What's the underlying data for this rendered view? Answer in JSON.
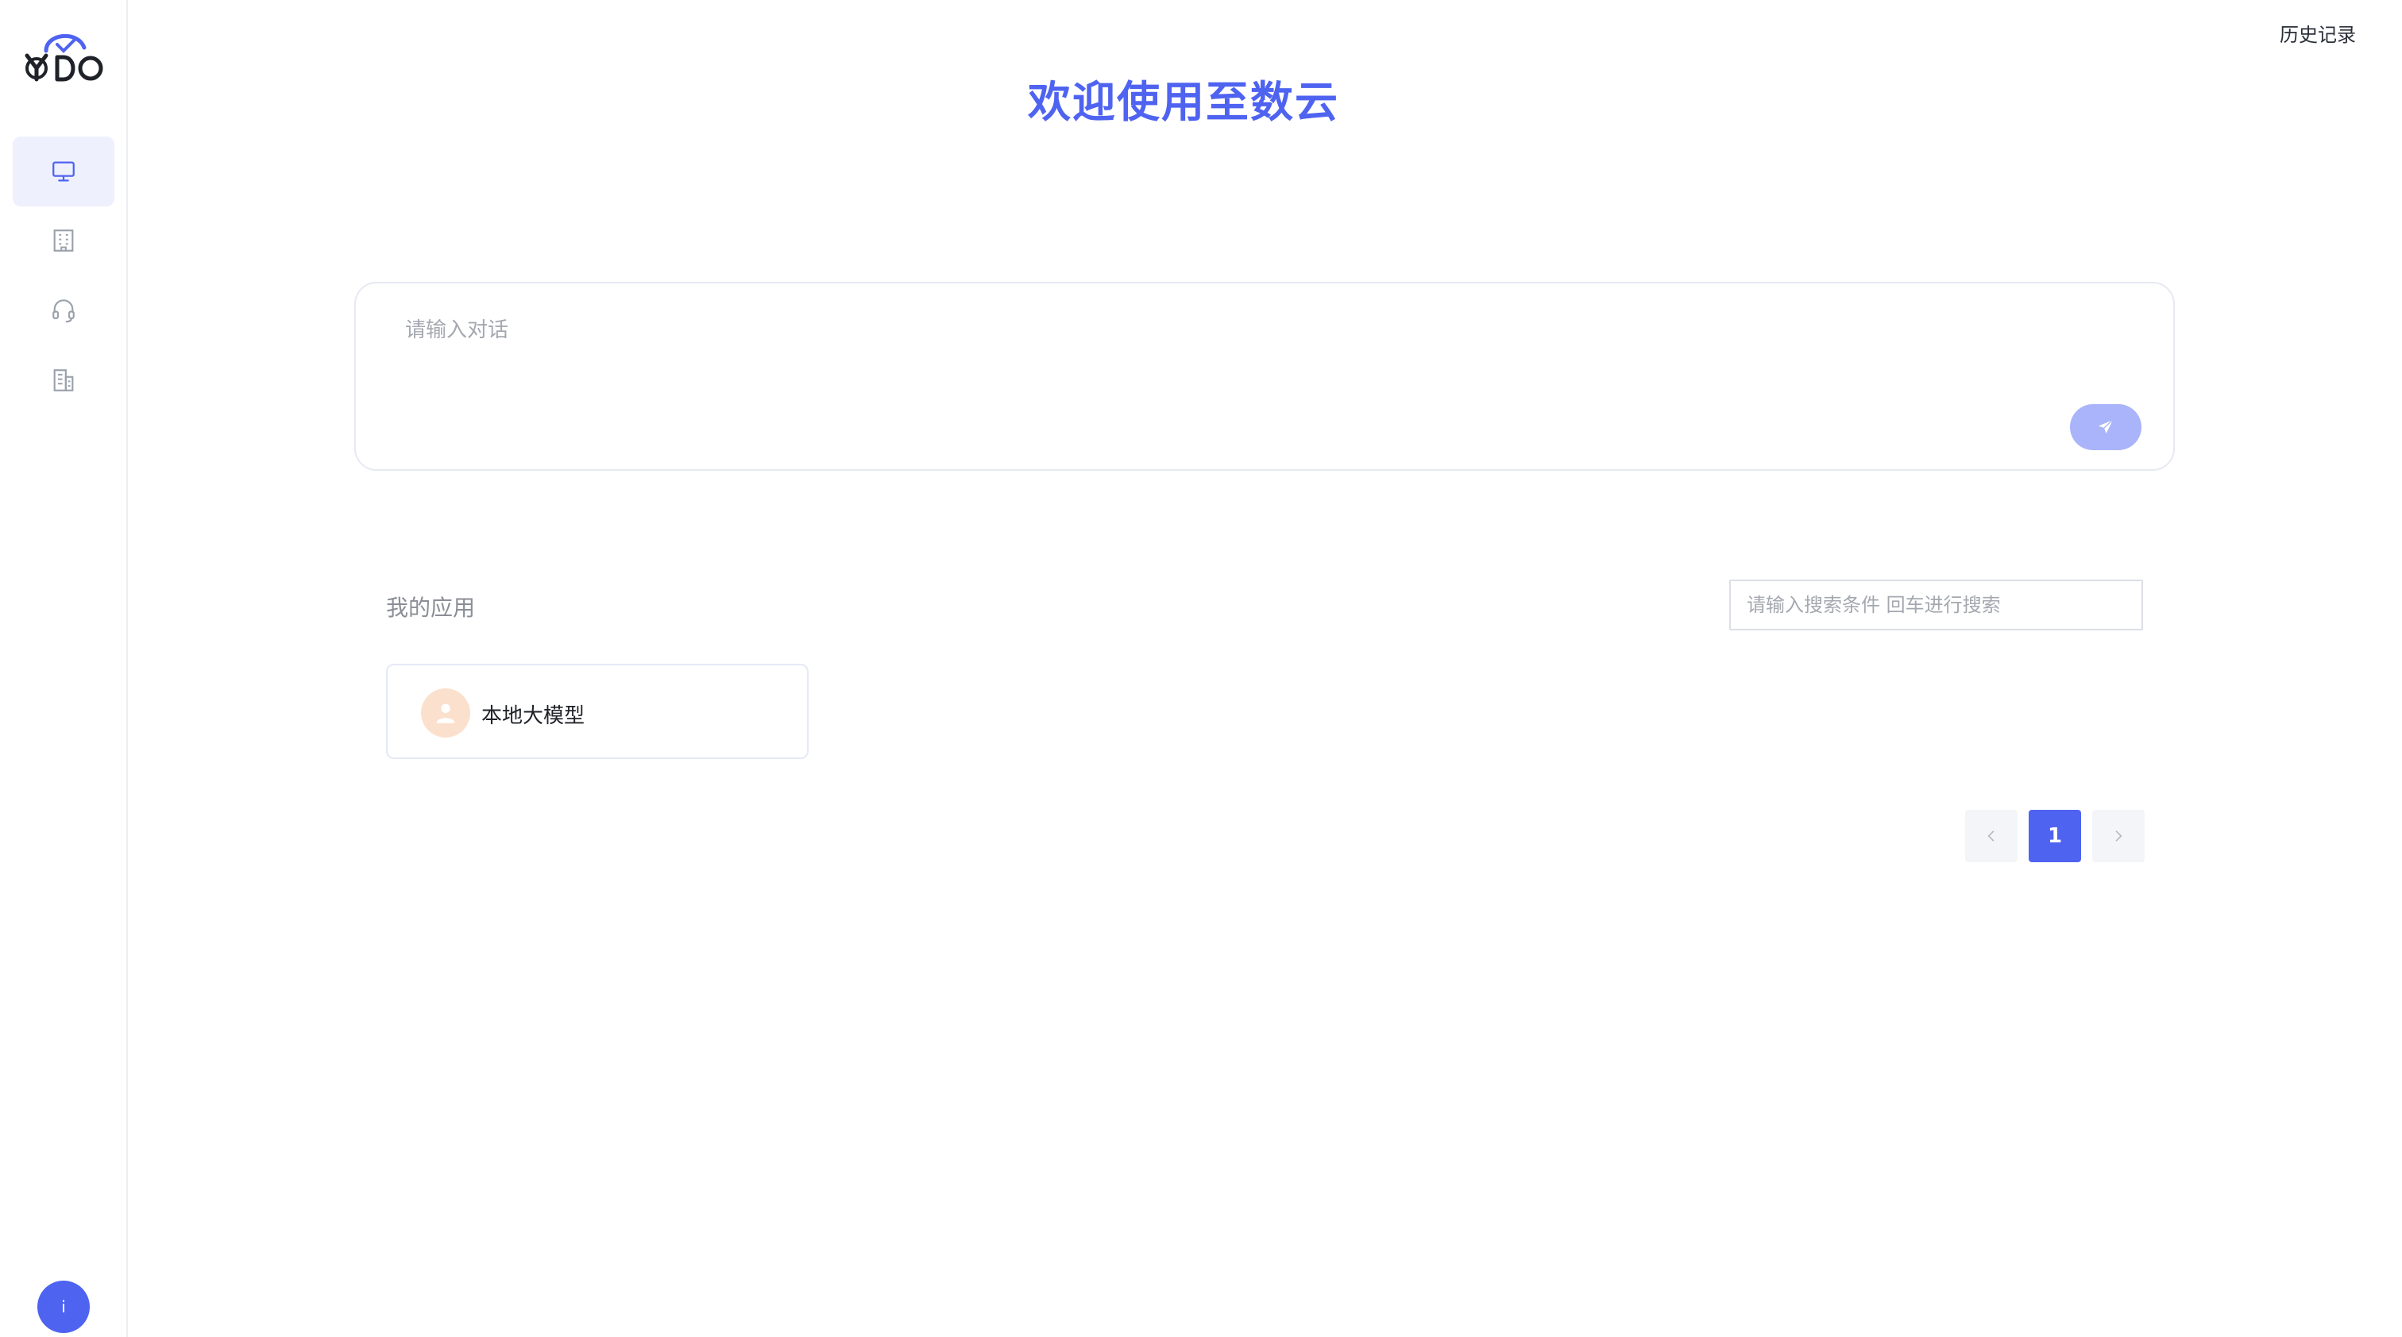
{
  "header": {
    "history_label": "历史记录",
    "title": "欢迎使用至数云"
  },
  "sidebar": {
    "logo_text": "YDO",
    "items": [
      {
        "icon": "monitor-icon",
        "active": true
      },
      {
        "icon": "office-building-icon",
        "active": false
      },
      {
        "icon": "headset-icon",
        "active": false
      },
      {
        "icon": "company-building-icon",
        "active": false
      }
    ],
    "avatar_label": "i"
  },
  "chat": {
    "placeholder": "请输入对话",
    "send_icon": "send-icon"
  },
  "apps": {
    "section_title": "我的应用",
    "search_placeholder": "请输入搜索条件 回车进行搜索",
    "items": [
      {
        "name": "本地大模型",
        "icon": "user-icon"
      }
    ]
  },
  "pagination": {
    "current_page": "1"
  },
  "colors": {
    "primary": "#4f63f1",
    "send_button": "#a9b4fa",
    "active_nav_bg": "#eef0fd",
    "app_avatar_bg": "#fbe1cd",
    "muted_text": "#8b8e96"
  }
}
